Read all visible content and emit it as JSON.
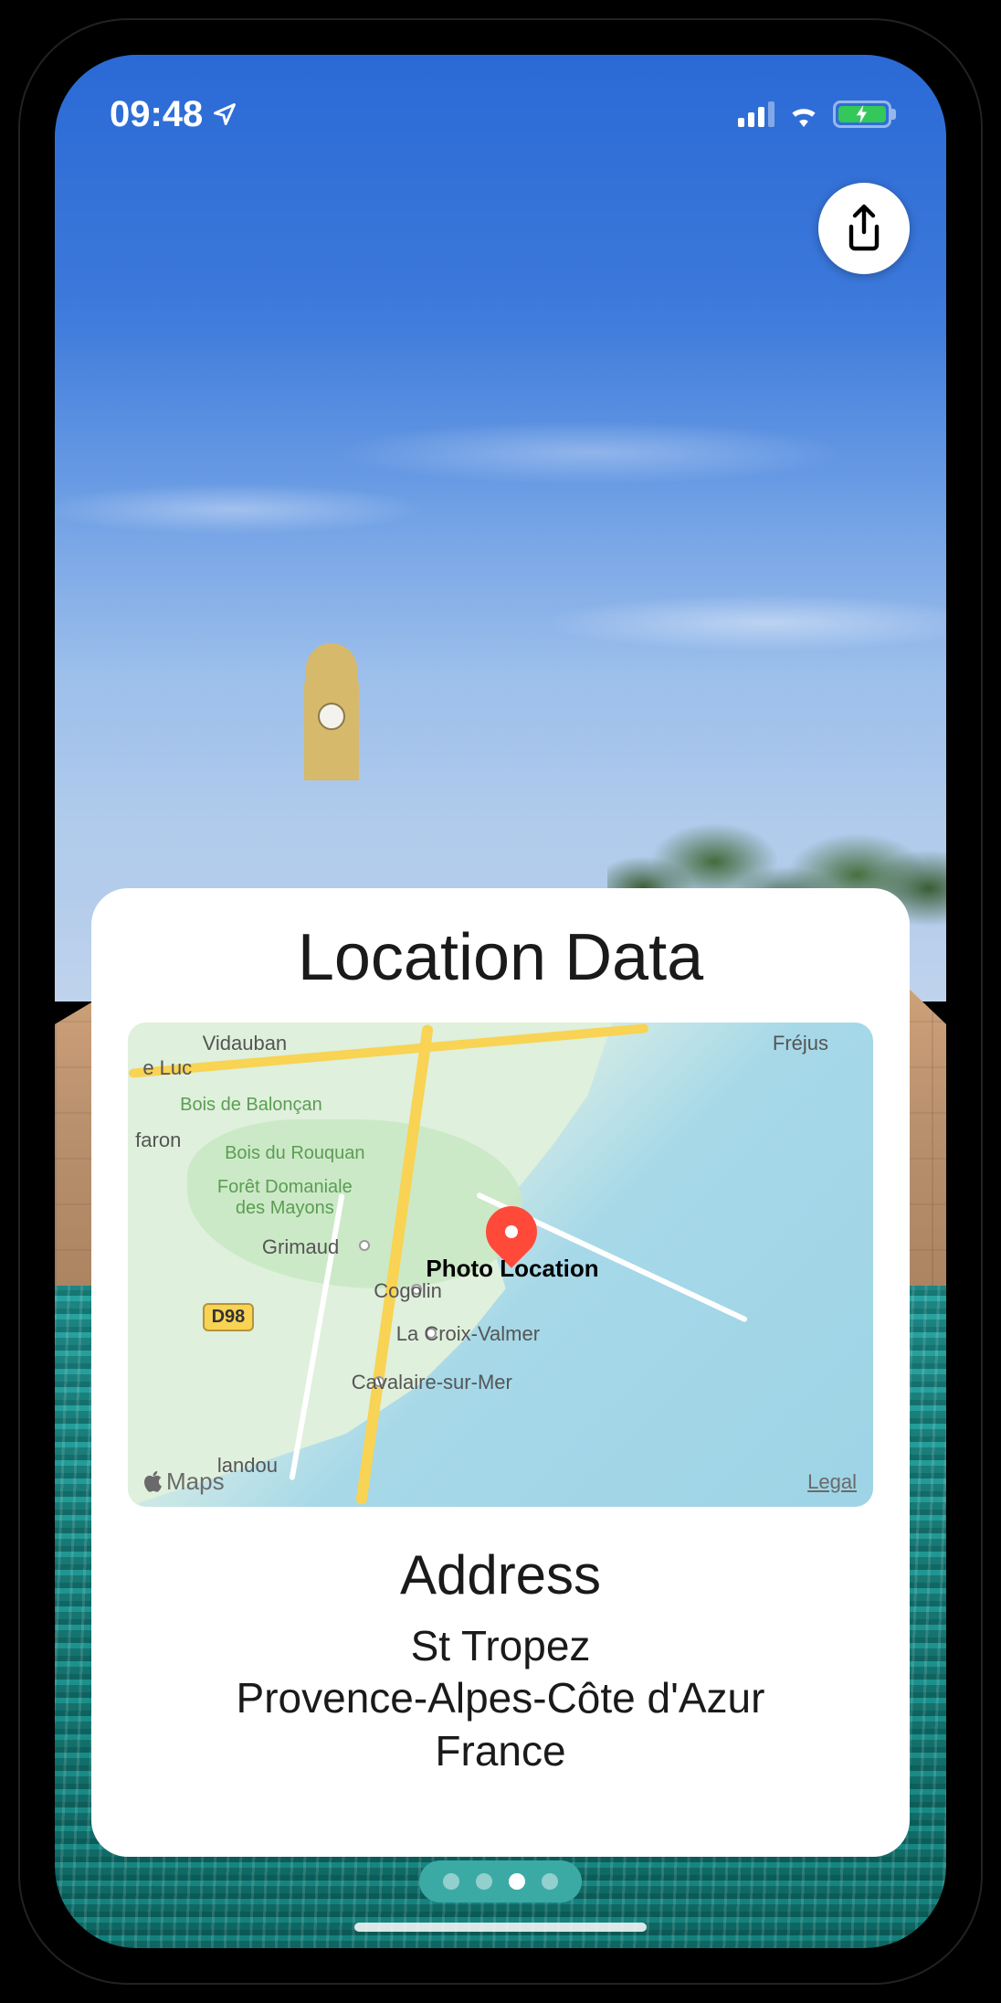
{
  "statusBar": {
    "time": "09:48",
    "indicators": {
      "locationActive": true,
      "signalBars": 3,
      "wifiConnected": true,
      "batteryCharging": true
    }
  },
  "shareButton": {
    "icon": "share-icon"
  },
  "card": {
    "title": "Location Data",
    "map": {
      "pinLabel": "Photo Location",
      "provider": "Maps",
      "legal": "Legal",
      "routeBadge": "D98",
      "places": {
        "vidauban": "Vidauban",
        "leLuc": "e Luc",
        "faron": "faron",
        "boisDeBaloncan": "Bois de Balonçan",
        "boisDuRouquan": "Bois du Rouquan",
        "foretDomaniale": "Forêt Domaniale\ndes Mayons",
        "grimaud": "Grimaud",
        "cogolin": "Cogolin",
        "laCroixValmer": "La Croix-Valmer",
        "cavalaireSurMer": "Cavalaire-sur-Mer",
        "landou": "landou",
        "frejus": "Fréjus"
      }
    },
    "address": {
      "title": "Address",
      "line1": "St Tropez",
      "line2": "Provence-Alpes-Côte d'Azur",
      "line3": "France"
    }
  },
  "pageControl": {
    "count": 4,
    "activeIndex": 2
  }
}
